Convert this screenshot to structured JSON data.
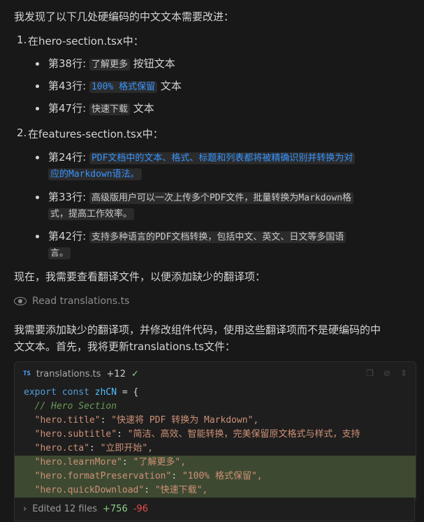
{
  "intro": "我发现了以下几处硬编码的中文文本需要改进：",
  "section1": {
    "num": "1.",
    "title": "在hero-section.tsx中：",
    "items": [
      {
        "prefix": "第38行:",
        "code": "了解更多",
        "suffix": "按钮文本"
      },
      {
        "prefix": "第43行:",
        "code": "100% 格式保留",
        "suffix": "文本"
      },
      {
        "prefix": "第47行:",
        "code": "快速下载",
        "suffix": "文本"
      }
    ]
  },
  "section2": {
    "num": "2.",
    "title": "在features-section.tsx中：",
    "items": [
      {
        "prefix": "第24行:",
        "line1": "PDF文档中的文本、格式、标题和列表都将被精确识别并转换为对",
        "line2": "应的Markdown语法。"
      },
      {
        "prefix": "第33行:",
        "line1": "高级版用户可以一次上传多个PDF文件，批量转换为Markdown格",
        "line2": "式，提高工作效率。"
      },
      {
        "prefix": "第42行:",
        "line1": "支持多种语言的PDF文档转换，包括中文、英文、日文等多国语",
        "line2": "言。"
      }
    ]
  },
  "check_text": "现在，我需要查看翻译文件，以便添加缺少的翻译项：",
  "read_action": "Read translations.ts",
  "plan_line1": "我需要添加缺少的翻译项，并修改组件代码，使用这些翻译项而不是硬编码的中",
  "plan_line2": "文文本。首先，我将更新translations.ts文件：",
  "file_panel": {
    "lang_badge": "TS",
    "filename": "translations.ts",
    "added": "+12",
    "check": "✓",
    "code_lines": [
      {
        "kw": "export const ",
        "var": "zhCN",
        "rest": " = {"
      },
      {
        "comment": "  // Hero Section"
      },
      {
        "key": "  \"hero.title\"",
        "val": "\"快速将 PDF 转换为 Markdown\","
      },
      {
        "key": "  \"hero.subtitle\"",
        "val": "\"简洁、高效、智能转换，完美保留原文格式与样式，支持"
      },
      {
        "key": "  \"hero.cta\"",
        "val": "\"立即开始\","
      },
      {
        "key": "  \"hero.learnMore\"",
        "val": "\"了解更多\","
      },
      {
        "key": "  \"hero.formatPreservation\"",
        "val": "\"100% 格式保留\","
      },
      {
        "key": "  \"hero.quickDownload\"",
        "val": "\"快速下载\","
      }
    ]
  },
  "footer": {
    "label": "Edited 12 files",
    "added": "+756",
    "removed": "-96"
  }
}
